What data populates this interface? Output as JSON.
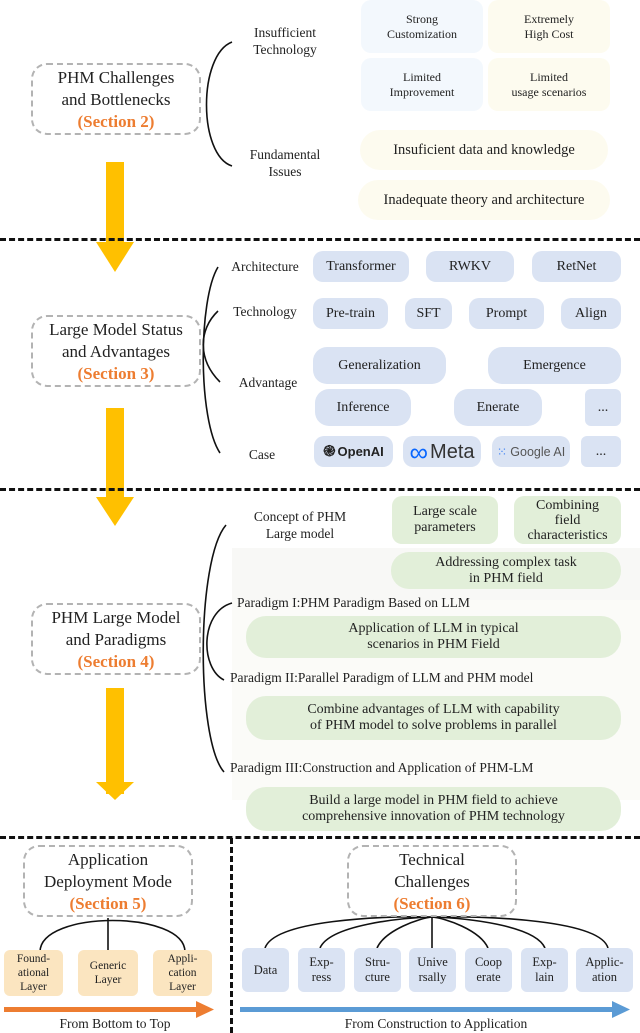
{
  "colors": {
    "section_accent": "#ed7d31",
    "flow_arrow": "#ffc000",
    "bottom_left_arrow": "#ed7d31",
    "bottom_right_arrow": "#5b9bd5",
    "pill_lavender": "#dae3f3",
    "pill_green": "#e2efd9",
    "pill_tan": "#fbe5c0"
  },
  "section2": {
    "title_line1": "PHM Challenges",
    "title_line2": "and Bottlenecks",
    "section": "(Section 2)",
    "branches": [
      {
        "label_line1": "Insufficient",
        "label_line2": "Technology"
      },
      {
        "label_line1": "Fundamental",
        "label_line2": "Issues"
      }
    ],
    "tech_items": [
      {
        "line1": "Strong",
        "line2": "Customization"
      },
      {
        "line1": "Extremely",
        "line2": "High Cost"
      },
      {
        "line1": "Limited",
        "line2": "Improvement"
      },
      {
        "line1": "Limited",
        "line2": "usage scenarios"
      }
    ],
    "fundamental_items": [
      "Insuficient data and knowledge",
      "Inadequate theory and architecture"
    ]
  },
  "section3": {
    "title_line1": "Large Model Status",
    "title_line2": "and Advantages",
    "section": "(Section 3)",
    "branches": [
      "Architecture",
      "Technology",
      "Advantage",
      "Case"
    ],
    "architecture": [
      "Transformer",
      "RWKV",
      "RetNet"
    ],
    "technology": [
      "Pre-train",
      "SFT",
      "Prompt",
      "Align"
    ],
    "advantage": [
      "Generalization",
      "Emergence",
      "Inference",
      "Enerate",
      "..."
    ],
    "case": [
      {
        "icon": "openai-logo-icon",
        "glyph": "֎",
        "text": "OpenAI"
      },
      {
        "icon": "meta-logo-icon",
        "glyph": "∞",
        "text": "Meta"
      },
      {
        "icon": "google-ai-logo-icon",
        "glyph": "⁙",
        "text": "Google AI"
      },
      {
        "icon": "",
        "glyph": "",
        "text": "..."
      }
    ]
  },
  "section4": {
    "title_line1": "PHM Large Model",
    "title_line2": "and Paradigms",
    "section": "(Section 4)",
    "concept_label_line1": "Concept of PHM",
    "concept_label_line2": "Large model",
    "concept_items": [
      {
        "line1": "Large scale",
        "line2": "parameters"
      },
      {
        "line1": "Combining",
        "line2": "field",
        "line3": "characteristics"
      },
      {
        "line1": "Addressing complex task",
        "line2": "in PHM field"
      }
    ],
    "paradigms": [
      {
        "label": "Paradigm I:PHM Paradigm Based on LLM",
        "desc_line1": "Application of LLM in typical",
        "desc_line2": "scenarios in PHM Field"
      },
      {
        "label": "Paradigm II:Parallel Paradigm of LLM and PHM model",
        "desc_line1": "Combine advantages of LLM  with capability",
        "desc_line2": "of PHM model to solve problems in parallel"
      },
      {
        "label": "Paradigm III:Construction and Application of PHM-LM",
        "desc_line1": "Build a large model in PHM field to achieve",
        "desc_line2": "comprehensive innovation of PHM technology"
      }
    ]
  },
  "section5": {
    "title_line1": "Application",
    "title_line2": "Deployment Mode",
    "section": "(Section 5)",
    "layers": [
      {
        "line1": "Found-",
        "line2": "ational",
        "line3": "Layer"
      },
      {
        "line1": "Generic",
        "line2": "Layer",
        "line3": ""
      },
      {
        "line1": "Appli-",
        "line2": "cation",
        "line3": "Layer"
      }
    ],
    "arrow_label": "From Bottom to Top"
  },
  "section6": {
    "title_line1": "Technical",
    "title_line2": "Challenges",
    "section": "(Section 6)",
    "items": [
      {
        "line1": "Data",
        "line2": ""
      },
      {
        "line1": "Exp-",
        "line2": "ress"
      },
      {
        "line1": "Stru-",
        "line2": "cture"
      },
      {
        "line1": "Unive",
        "line2": "rsally"
      },
      {
        "line1": "Coop",
        "line2": "erate"
      },
      {
        "line1": "Exp-",
        "line2": "lain"
      },
      {
        "line1": "Applic-",
        "line2": "ation"
      }
    ],
    "arrow_label": "From Construction to Application"
  }
}
